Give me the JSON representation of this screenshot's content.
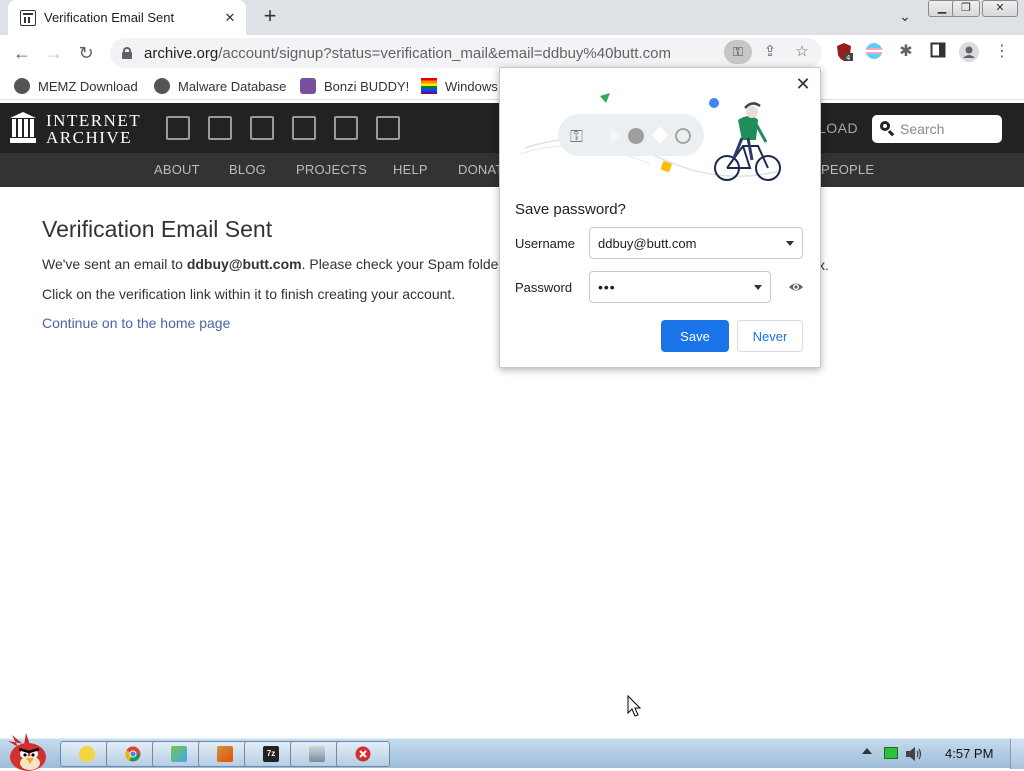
{
  "browser": {
    "tab_title": "Verification Email Sent",
    "url_host": "archive.org",
    "url_rest": "/account/signup?status=verification_mail&email=ddbuy%40butt.com"
  },
  "bookmarks": [
    {
      "label": "MEMZ Download"
    },
    {
      "label": "Malware Database"
    },
    {
      "label": "Bonzi BUDDY!"
    },
    {
      "label": "Windows"
    }
  ],
  "ia": {
    "wordmark_line1": "INTERNET",
    "wordmark_line2": "ARCHIVE",
    "upload_fragment": "LOAD",
    "search_placeholder": "Search",
    "subnav": [
      "ABOUT",
      "BLOG",
      "PROJECTS",
      "HELP",
      "DONAT",
      "PEOPLE"
    ]
  },
  "content": {
    "heading": "Verification Email Sent",
    "line1_prefix": "We've sent an email to ",
    "line1_email": "ddbuy@butt.com",
    "line1_suffix": ". Please check your Spam folde",
    "line1_tail": "x.",
    "line2": "Click on the verification link within it to finish creating your account.",
    "link": "Continue on to the home page"
  },
  "password_bubble": {
    "title": "Save password?",
    "username_label": "Username",
    "username_value": "ddbuy@butt.com",
    "password_label": "Password",
    "password_value": "•••",
    "save_label": "Save",
    "never_label": "Never",
    "close_glyph": "✕"
  },
  "taskbar": {
    "clock": "4:57 PM"
  },
  "colors": {
    "save_button": "#1a73e8",
    "ia_header": "#222222",
    "ia_subnav": "#333333",
    "link": "#4b64a4"
  }
}
